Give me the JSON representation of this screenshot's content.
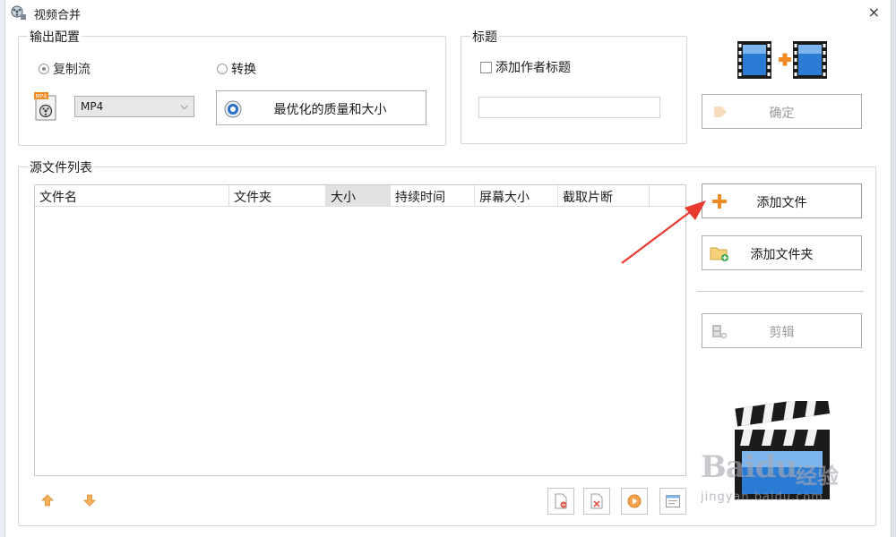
{
  "window": {
    "title": "视频合并",
    "close_glyph": "×"
  },
  "output": {
    "legend": "输出配置",
    "radio_copy": "复制流",
    "radio_convert": "转换",
    "format_value": "MP4",
    "optimize_label": "最优化的质量和大小"
  },
  "title_group": {
    "legend": "标题",
    "add_author_label": "添加作者标题",
    "title_value": ""
  },
  "actions": {
    "confirm_label": "确定",
    "add_file_label": "添加文件",
    "add_folder_label": "添加文件夹",
    "edit_label": "剪辑"
  },
  "sources": {
    "legend": "源文件列表",
    "columns": [
      "文件名",
      "文件夹",
      "大小",
      "持续时间",
      "屏幕大小",
      "截取片断"
    ]
  },
  "watermark": {
    "brand": "Baidu",
    "brand_cn": "经验",
    "url": "jingyan.baidu.com"
  },
  "colors": {
    "accent_orange": "#f08a24",
    "arrow_red": "#e83a2f",
    "film_blue": "#2a7bd4"
  }
}
